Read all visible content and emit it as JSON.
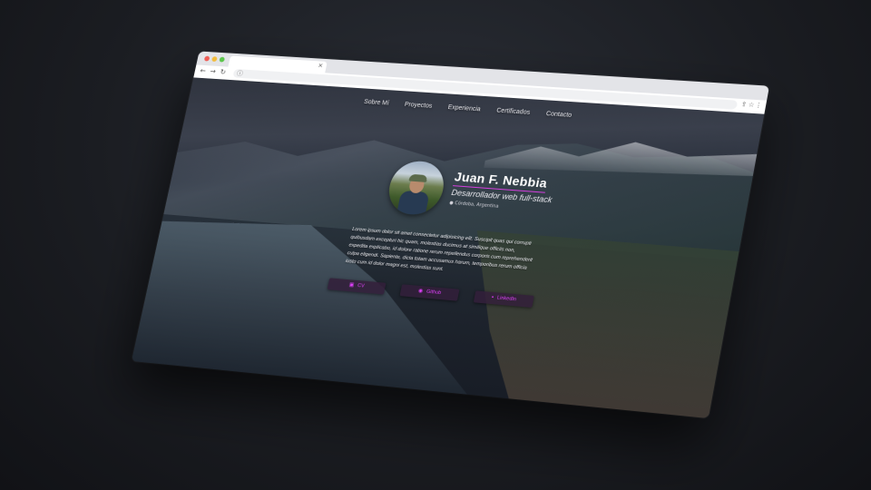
{
  "browser": {
    "tab_close": "×",
    "nav": {
      "back": "←",
      "forward": "→",
      "reload": "↻"
    },
    "url_icon": "ⓘ",
    "toolbar_icons": [
      "share-icon",
      "star-icon",
      "menu-icon"
    ]
  },
  "nav": {
    "items": [
      {
        "label": "Sobre Mí"
      },
      {
        "label": "Proyectos"
      },
      {
        "label": "Experiencia"
      },
      {
        "label": "Certificados"
      },
      {
        "label": "Contacto"
      }
    ]
  },
  "profile": {
    "name": "Juan F. Nebbia",
    "role": "Desarrollador web full-stack",
    "location": "Córdoba, Argentina"
  },
  "bio": "Lorem ipsum dolor sit amet consectetur adipisicing elit. Suscipit quas qui corrupti quibusdam excepturi hic quam, molestias ducimus at similique officiis non, expedita explicabo, id dolore ratione rerum repellendus corporis cum reprehenderit culpa eligendi. Sapiente, dicta totam accusamus harum, temporibus rerum officia iusto cum id dolor magni est, molestias sunt.",
  "buttons": [
    {
      "label": "CV",
      "icon": "briefcase-icon"
    },
    {
      "label": "Github",
      "icon": "github-icon"
    },
    {
      "label": "LinkedIn",
      "icon": "linkedin-icon"
    }
  ],
  "colors": {
    "accent": "#e040fb",
    "button_bg": "#32203a"
  }
}
